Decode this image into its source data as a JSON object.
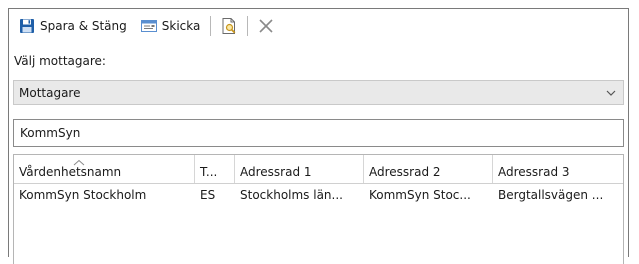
{
  "toolbar": {
    "save_close_label": "Spara & Stäng",
    "send_label": "Skicka"
  },
  "recipients": {
    "section_label": "Välj mottagare:",
    "combo_value": "Mottagare",
    "search_value": "KommSyn"
  },
  "grid": {
    "columns": [
      "Vårdenhetsnamn",
      "T...",
      "Adressrad 1",
      "Adressrad 2",
      "Adressrad 3"
    ],
    "rows": [
      [
        "KommSyn Stockholm",
        "ES",
        "Stockholms län...",
        "KommSyn Stoc...",
        "Bergtallsvägen ..."
      ]
    ]
  },
  "icons": {
    "save": "save-icon",
    "send": "send-icon",
    "document": "document-search-icon",
    "delete": "close-icon",
    "dropdown": "chevron-down-icon",
    "sort": "sort-ascending-icon"
  },
  "colors": {
    "combo_bg": "#e9e9e9",
    "save_icon": "#1f5fa8",
    "delete_icon": "#8a8a8a"
  }
}
